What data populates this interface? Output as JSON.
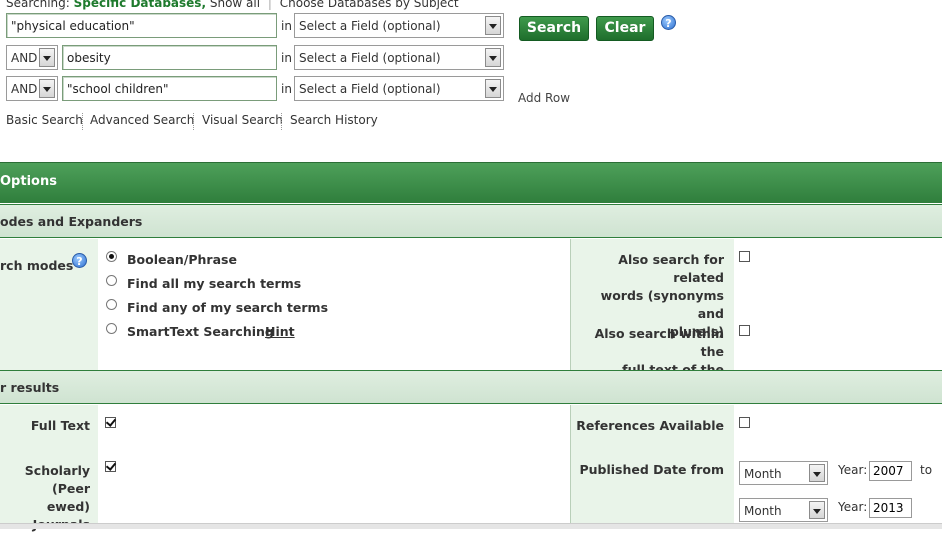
{
  "header": {
    "searching_label": "Searching:",
    "databases_link": "Specific Databases,",
    "show_all": "Show all",
    "choose_by_subject": "Choose Databases by Subject"
  },
  "search_rows": [
    {
      "term": "\"physical education\"",
      "field": "Select a Field (optional)"
    },
    {
      "bool": "AND",
      "term": "obesity",
      "field": "Select a Field (optional)"
    },
    {
      "bool": "AND",
      "term": "\"school children\"",
      "field": "Select a Field (optional)"
    }
  ],
  "in_label": "in",
  "buttons": {
    "search": "Search",
    "clear": "Clear",
    "help": "?"
  },
  "add_row": "Add Row",
  "nav": [
    "Basic Search",
    "Advanced Search",
    "Visual Search",
    "Search History"
  ],
  "options_title": "Options",
  "modes_section": {
    "title": "odes and Expanders",
    "search_modes_label": "rch modes",
    "modes": [
      {
        "label": "Boolean/Phrase",
        "selected": true
      },
      {
        "label": "Find all my search terms",
        "selected": false
      },
      {
        "label": "Find any of my search terms",
        "selected": false
      },
      {
        "label": "SmartText Searching",
        "selected": false
      }
    ],
    "hint": "Hint",
    "related_words": {
      "line1": "Also search for related",
      "line2": "words (synonyms and",
      "line3": "plurals)",
      "checked": false
    },
    "full_text_search": {
      "line1": "Also search within the",
      "line2": "full text of the articles",
      "checked": false
    }
  },
  "limit_section": {
    "title": "r results",
    "full_text": {
      "label": "Full Text",
      "checked": true
    },
    "scholarly": {
      "line1": "Scholarly (Peer",
      "line2": "ewed) Journals",
      "checked": true
    },
    "references": {
      "label": "References Available",
      "checked": false
    },
    "published_date": {
      "label": "Published Date from",
      "from_month": "Month",
      "from_year_label": "Year:",
      "from_year": "2007",
      "to_label": "to",
      "to_month": "Month",
      "to_year_label": "Year:",
      "to_year": "2013"
    }
  }
}
